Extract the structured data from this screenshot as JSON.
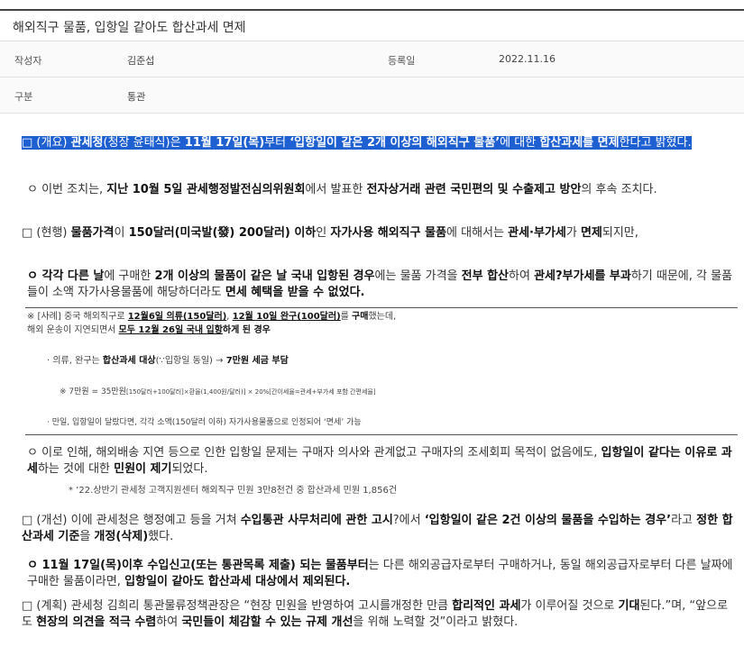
{
  "header": {
    "title": "해외직구 물품, 입항일 같아도 합산과세 면제"
  },
  "meta": {
    "author_label": "작성자",
    "author": "김준섭",
    "date_label": "등록일",
    "date": "2022.11.16",
    "category_label": "구분",
    "category": "통관"
  },
  "body": {
    "p1_a": "□ (개요) ",
    "p1_b": "관세청",
    "p1_c": "(청장 윤태식)은 ",
    "p1_d": "11월 17일(목)",
    "p1_e": "부터 ",
    "p1_f": "‘입항일이 같은 2개 이상의 해외직구 물품’",
    "p1_g": "에 대한 ",
    "p1_h": "합산과세를 면제",
    "p1_i": "한다고 밝혔다.",
    "p2_a": "ㅇ 이번 조치는, ",
    "p2_b": "지난 10월 5일 관세행정발전심의위원회",
    "p2_c": "에서 발표한 ",
    "p2_d": "전자상거래 관련 국민편의 및 수출제고 방안",
    "p2_e": "의 후속 조치다.",
    "p3_a": "□ (현행) ",
    "p3_b": "물품가격",
    "p3_c": "이 ",
    "p3_d": "150달러(미국발(發) 200달러) 이하",
    "p3_e": "인 ",
    "p3_f": "자가사용 해외직구 물품",
    "p3_g": "에 대해서는 ",
    "p3_h": "관세·부가세",
    "p3_i": "가 ",
    "p3_j": "면제",
    "p3_k": "되지만,",
    "p4_a": "ㅇ 각각 다른 날",
    "p4_b": "에 구매한 ",
    "p4_c": "2개 이상",
    "p4_d": "의 물품이 같은 날 국내 입항된 경우",
    "p4_e": "에는 물품 가격을 ",
    "p4_f": "전부 합산",
    "p4_g": "하여 ",
    "p4_h": "관세?부가세를 부과",
    "p4_i": "하기 때문에, 각 물품들이 소액 자가사용물품에 해당하더라도 ",
    "p4_j": "면세 혜택을 받을 수 없었다.",
    "ex1_a": "※ [사례] 중국 해외직구로 ",
    "ex1_b": "12월6일 의류(150달러)",
    "ex1_c": ", ",
    "ex1_d": "12월 10일 완구(100달러)",
    "ex1_e": "를 ",
    "ex1_f": "구매",
    "ex1_g": "했는데,",
    "ex2_a": "해외 운송이 지연되면서 ",
    "ex2_b": "모두 12월 26일 국내 입항",
    "ex2_c": "하게 된 경우",
    "ex3_a": "· 의류, 완구는 ",
    "ex3_b": "합산과세 대상",
    "ex3_c": "(∵입항일 동일) → ",
    "ex3_d": "7만원 세금 부담",
    "ex4_a": "※ 7만원 = 35만원",
    "ex4_b": "[150달러+100달러]×환율(1,400원/달러)] × 20%[간이세율=관세+부가세 포함 간편세율]",
    "ex5": "· 만일, 입항일이 달랐다면, 각각 소액(150달러 이하) 자가사용물품으로 인정되어 ‘면세’ 가능",
    "p5_a": "ㅇ 이로 인해, 해외배송 지연 등으로 인한 입항일 문제는 구매자 의사와 관계없고 구매자의 조세회피 목적이 없음에도, ",
    "p5_b": "입항일이 같다는 이유로 과세",
    "p5_c": "하는 것에 대한 ",
    "p5_d": "민원이 제기",
    "p5_e": "되었다.",
    "p5_note": "* ’22.상반기 관세청 고객지원센터 해외직구 민원 3만8천건 중 합산과세 민원 1,856건",
    "p6_a": "□ (개선) 이에 관세청은 행정예고 등을 거쳐 ",
    "p6_b": "수입통관 사무처리에 관한 고시",
    "p6_c": "?에서 ",
    "p6_d": "‘입항일이 같은 2건 이상의 물품을 수입하는 경우’",
    "p6_e": "라고 ",
    "p6_f": "정한 합산과세 기준",
    "p6_g": "을 ",
    "p6_h": "개정(삭제)",
    "p6_i": "했다.",
    "p7_a": "ㅇ 11월 17일(목)이후 수입신고(또는 통관목록 제출) 되는 물품부터",
    "p7_b": "는 다른 해외공급자로부터 구매하거나, 동일 해외공급자로부터 다른 날짜에 구매한 물품이라면, ",
    "p7_c": "입항일이 같아도 합산과세 대상에서 제외된다.",
    "p8_a": "□ (계획) 관세청 김희리 통관물류정책관장은 “현장 민원을 반영하여 고시를개정한 만큼 ",
    "p8_b": "합리적인 과세",
    "p8_c": "가 이루어질 것으로 ",
    "p8_d": "기대",
    "p8_e": "된다.”며, “앞으로도 ",
    "p8_f": "현장의 의견을 적극 수렴",
    "p8_g": "하여 ",
    "p8_h": "국민들이 체감할 수 있는 규제 개선",
    "p8_i": "을 위해 노력할 것”이라고 밝혔다."
  }
}
